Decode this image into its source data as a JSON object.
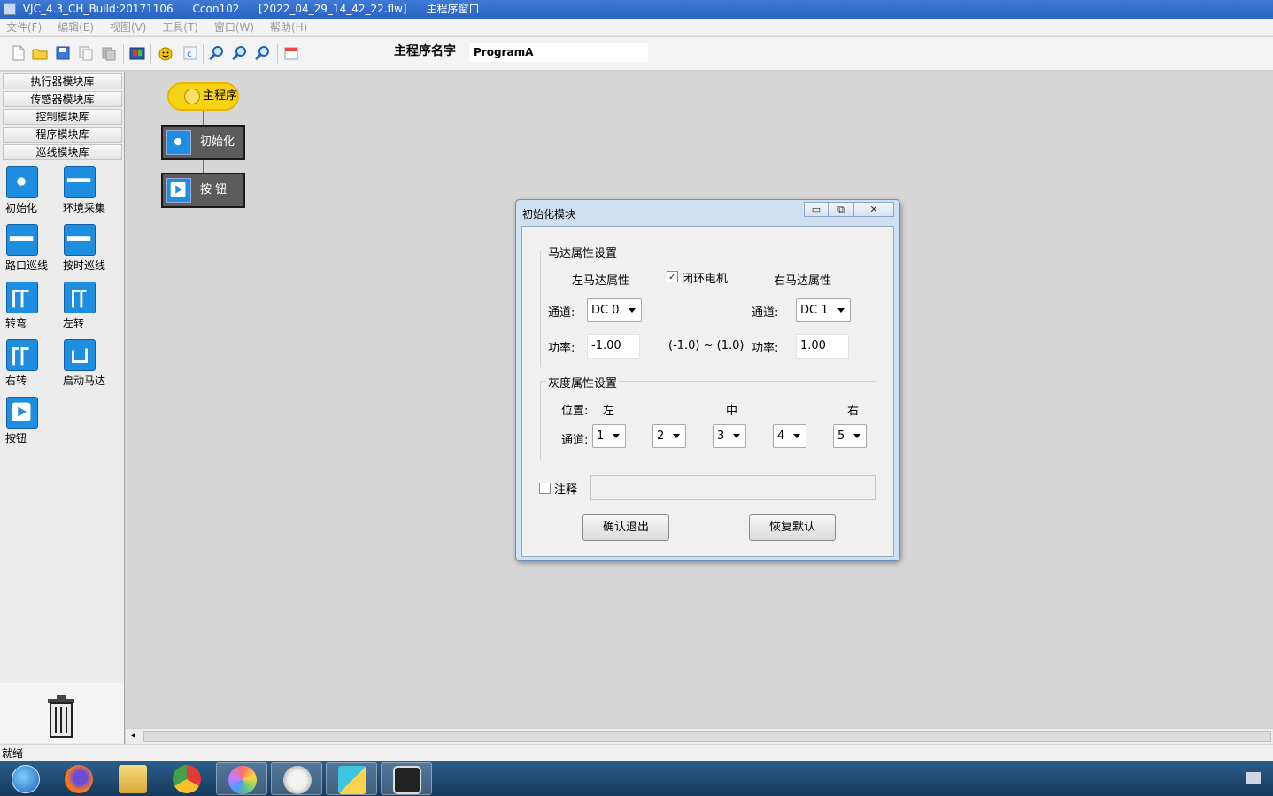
{
  "window": {
    "app": "VJC_4.3_CH_Build:20171106",
    "user": "Ccon102",
    "file": "[2022_04_29_14_42_22.flw]",
    "view": "主程序窗口"
  },
  "menu": [
    "文件(F)",
    "编辑(E)",
    "视图(V)",
    "工具(T)",
    "窗口(W)",
    "帮助(H)"
  ],
  "toolbar": {
    "icons": [
      "new-file-icon",
      "open-folder-icon",
      "save-icon",
      "copy-icon",
      "paste-icon",
      "download-icon",
      "smiley-icon",
      "code-icon",
      "zoom-in-icon",
      "zoom-out-icon",
      "zoom-fit-icon",
      "calendar-icon"
    ],
    "program_name_label": "主程序名字",
    "program_name_value": "ProgramA"
  },
  "libraries": [
    "执行器模块库",
    "传感器模块库",
    "控制模块库",
    "程序模块库",
    "巡线模块库"
  ],
  "palette": [
    {
      "label": "初始化",
      "icon": "init-icon"
    },
    {
      "label": "环境采集",
      "icon": "env-collect-icon"
    },
    {
      "label": "路口巡线",
      "icon": "crossing-line-icon"
    },
    {
      "label": "按时巡线",
      "icon": "timed-line-icon"
    },
    {
      "label": "转弯",
      "icon": "turn-icon"
    },
    {
      "label": "左转",
      "icon": "turn-left-icon"
    },
    {
      "label": "右转",
      "icon": "turn-right-icon"
    },
    {
      "label": "启动马达",
      "icon": "start-motor-icon"
    },
    {
      "label": "按钮",
      "icon": "button-icon"
    }
  ],
  "flowchart": {
    "start": "主程序",
    "blocks": [
      "初始化",
      "按 钮"
    ]
  },
  "dialog": {
    "title": "初始化模块",
    "controls": {
      "minimize": "▭",
      "restore": "⧉",
      "close": "✕"
    },
    "motor_group": "马达属性设置",
    "left_motor": "左马达属性",
    "closed_loop": "闭环电机",
    "closed_loop_checked": "✓",
    "right_motor": "右马达属性",
    "channel_label": "通道:",
    "power_label": "功率:",
    "left_channel": "DC 0",
    "right_channel": "DC 1",
    "left_power": "-1.00",
    "right_power": "1.00",
    "range": "(-1.0) ~ (1.0)",
    "gray_group": "灰度属性设置",
    "position_label": "位置:",
    "pos_left": "左",
    "pos_mid": "中",
    "pos_right": "右",
    "gray_channel_label": "通道:",
    "gray_channels": [
      "1",
      "2",
      "3",
      "4",
      "5"
    ],
    "note_label": "注释",
    "note_value": "",
    "confirm_button": "确认退出",
    "reset_button": "恢复默认"
  },
  "status": "就绪",
  "taskbar": [
    "start-orb-icon",
    "firefox-icon",
    "file-explorer-icon",
    "chrome-icon",
    "colorful-app-icon",
    "cat-app-icon",
    "flower-app-icon",
    "robot-app-icon"
  ]
}
